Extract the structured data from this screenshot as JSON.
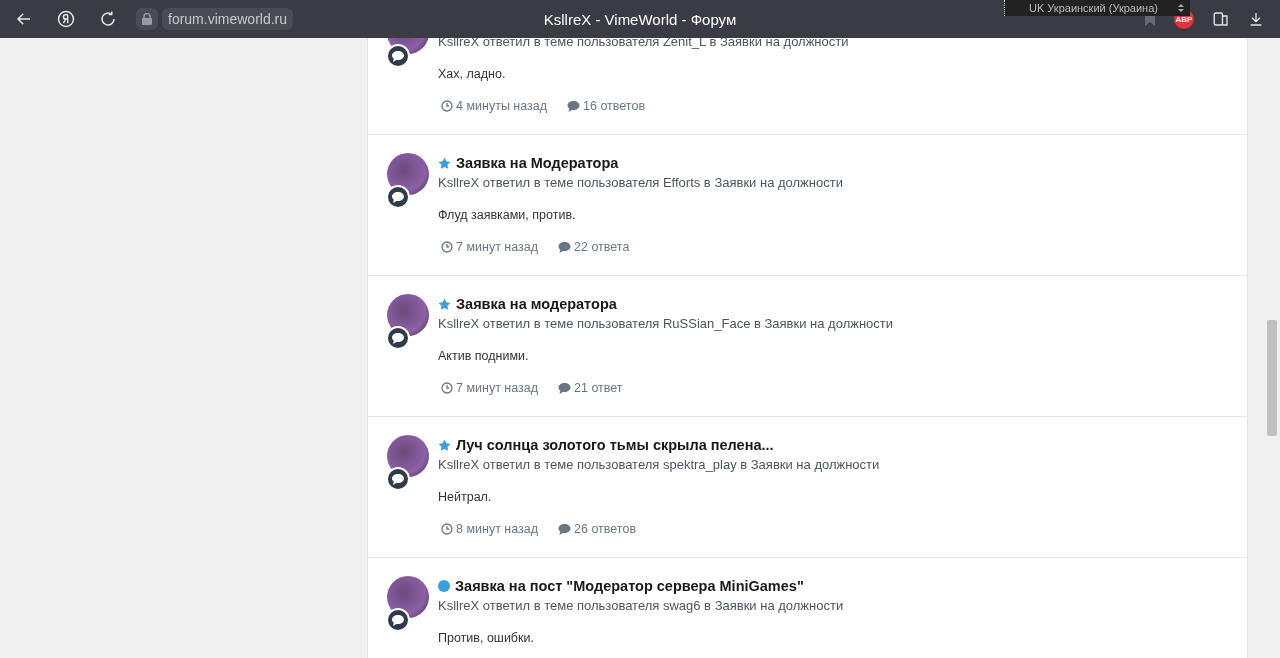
{
  "browser": {
    "url": "forum.vimeworld.ru",
    "title": "KsllreX - VimeWorld - Форум",
    "language_tooltip": "UK Украинский (Украина)",
    "extension_badge": "ABP"
  },
  "activity": [
    {
      "subtitle": "KsllreX ответил в теме пользователя Zenit_L в Заявки на должности",
      "excerpt": "Хах, ладно.",
      "time": "4 минуты назад",
      "replies": "16 ответов"
    },
    {
      "kind": "star",
      "title": "Заявка на Модератора",
      "subtitle": "KsllreX ответил в теме пользователя Efforts в Заявки на должности",
      "excerpt": "Флуд заявками, против.",
      "time": "7 минут назад",
      "replies": "22 ответа"
    },
    {
      "kind": "star",
      "title": "Заявка на модератора",
      "subtitle": "KsllreX ответил в теме пользователя RuSSian_Face в Заявки на должности",
      "excerpt": "Актив подними.",
      "time": "7 минут назад",
      "replies": "21 ответ"
    },
    {
      "kind": "star",
      "title": "Луч солнца золотого тьмы скрыла пелена...",
      "subtitle": "KsllreX ответил в теме пользователя spektra_play в Заявки на должности",
      "excerpt": "Нейтрал.",
      "time": "8 минут назад",
      "replies": "26 ответов"
    },
    {
      "kind": "dot",
      "title": "Заявка на пост \"Модератор сервера MiniGames\"",
      "subtitle": "KsllreX ответил в теме пользователя swag6 в Заявки на должности",
      "excerpt": "Против, ошибки."
    }
  ]
}
